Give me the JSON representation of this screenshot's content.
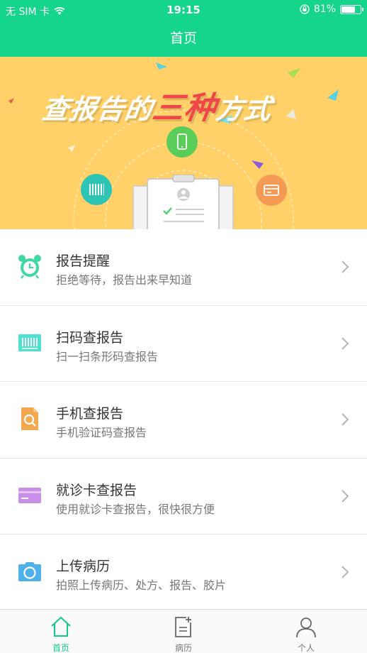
{
  "status_bar": {
    "carrier": "无 SIM 卡",
    "time": "19:15",
    "battery": "81%",
    "battery_level": 0.81
  },
  "nav": {
    "title": "首页"
  },
  "banner": {
    "headline_part1": "查报告的",
    "headline_highlight": "三种",
    "headline_part2": "方式"
  },
  "menu": [
    {
      "title": "报告提醒",
      "subtitle": "拒绝等待，报告出来早知道",
      "icon": "alarm-clock-icon",
      "color": "#3fd8a0"
    },
    {
      "title": "扫码查报告",
      "subtitle": "扫一扫条形码查报告",
      "icon": "barcode-icon",
      "color": "#4ee0d0"
    },
    {
      "title": "手机查报告",
      "subtitle": "手机验证码查报告",
      "icon": "document-search-icon",
      "color": "#f3a74f"
    },
    {
      "title": "就诊卡查报告",
      "subtitle": "使用就诊卡查报告，很快很方便",
      "icon": "card-icon",
      "color": "#c98ee8"
    },
    {
      "title": "上传病历",
      "subtitle": "拍照上传病历、处方、报告、胶片",
      "icon": "camera-icon",
      "color": "#4fb0ea"
    }
  ],
  "tabbar": {
    "tabs": [
      {
        "label": "首页",
        "icon": "home-icon",
        "active": true
      },
      {
        "label": "病历",
        "icon": "medical-record-icon",
        "active": false
      },
      {
        "label": "个人",
        "icon": "person-icon",
        "active": false
      }
    ]
  },
  "colors": {
    "primary": "#14d58a",
    "banner_bg": "#ffd168",
    "highlight": "#f0464a"
  }
}
